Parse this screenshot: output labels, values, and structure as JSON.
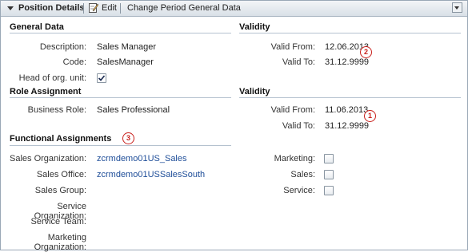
{
  "header": {
    "title": "Position Details",
    "edit_label": "Edit",
    "change_label": "Change Period General Data"
  },
  "general_data": {
    "heading": "General Data",
    "description_label": "Description:",
    "description_value": "Sales Manager",
    "code_label": "Code:",
    "code_value": "SalesManager",
    "head_label": "Head of org. unit:",
    "head_checked": true
  },
  "validity_general": {
    "heading": "Validity",
    "from_label": "Valid From:",
    "from_value": "12.06.2013",
    "to_label": "Valid To:",
    "to_value": "31.12.9999",
    "badge": "2"
  },
  "role_assignment": {
    "heading": "Role Assignment",
    "role_label": "Business Role:",
    "role_value": "Sales Professional"
  },
  "validity_role": {
    "heading": "Validity",
    "from_label": "Valid From:",
    "from_value": "11.06.2013",
    "to_label": "Valid To:",
    "to_value": "31.12.9999",
    "badge": "1"
  },
  "functional": {
    "heading": "Functional Assignments",
    "badge": "3",
    "rows": [
      {
        "label": "Sales Organization:",
        "value": "zcrmdemo01US_Sales"
      },
      {
        "label": "Sales Office:",
        "value": "zcrmdemo01USSalesSouth"
      },
      {
        "label": "Sales Group:",
        "value": ""
      },
      {
        "label": "Service Organization:",
        "value": ""
      },
      {
        "label": "Service Team:",
        "value": ""
      },
      {
        "label": "Marketing Organization:",
        "value": ""
      }
    ],
    "checks": [
      {
        "label": "Marketing:",
        "checked": false
      },
      {
        "label": "Sales:",
        "checked": false
      },
      {
        "label": "Service:",
        "checked": false
      }
    ]
  }
}
